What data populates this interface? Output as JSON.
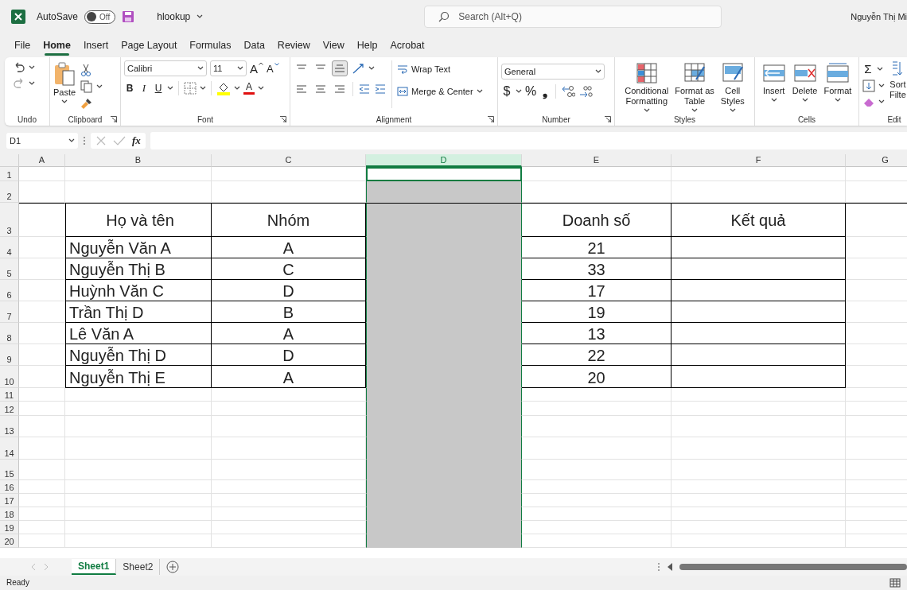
{
  "title_bar": {
    "autosave_label": "AutoSave",
    "autosave": {
      "on": false,
      "label": "Off"
    },
    "filename": "hlookup",
    "search": {
      "placeholder": "Search (Alt+Q)"
    },
    "user": "Nguyễn Thị Mi"
  },
  "menu_tabs": [
    {
      "label": "File",
      "selected": false
    },
    {
      "label": "Home",
      "selected": true
    },
    {
      "label": "Insert",
      "selected": false
    },
    {
      "label": "Page Layout",
      "selected": false
    },
    {
      "label": "Formulas",
      "selected": false
    },
    {
      "label": "Data",
      "selected": false
    },
    {
      "label": "Review",
      "selected": false
    },
    {
      "label": "View",
      "selected": false
    },
    {
      "label": "Help",
      "selected": false
    },
    {
      "label": "Acrobat",
      "selected": false
    }
  ],
  "ribbon": {
    "undo": {
      "label": "Undo"
    },
    "clipboard": {
      "paste": "Paste",
      "label": "Clipboard"
    },
    "font": {
      "name": "Calibri",
      "size": "11",
      "grow": "A",
      "shrink": "A",
      "bold": "B",
      "italic": "I",
      "underline": "U",
      "color_letter": "A",
      "label": "Font"
    },
    "alignment": {
      "bottom_align_selected": true,
      "wrap_text": "Wrap Text",
      "merge": "Merge & Center",
      "label": "Alignment"
    },
    "number": {
      "format": "General",
      "currency": "$",
      "percent": "%",
      "comma": "❟",
      "label": "Number"
    },
    "styles": {
      "buttons": [
        "Conditional\nFormatting",
        "Format as\nTable",
        "Cell\nStyles"
      ],
      "label": "Styles"
    },
    "cells": {
      "buttons": [
        "Insert",
        "Delete",
        "Format"
      ],
      "label": "Cells"
    },
    "editing": {
      "sum": "Σ",
      "sort": "Sort\nFilte",
      "label": "Edit"
    }
  },
  "formula_bar": {
    "name_box": "D1",
    "fx": "fx"
  },
  "columns": [
    {
      "label": "A",
      "selected": false
    },
    {
      "label": "B",
      "selected": false
    },
    {
      "label": "C",
      "selected": false
    },
    {
      "label": "D",
      "selected": true
    },
    {
      "label": "E",
      "selected": false
    },
    {
      "label": "F",
      "selected": false
    },
    {
      "label": "G",
      "selected": false
    }
  ],
  "rows": [
    {
      "header": "1",
      "kind": "empty"
    },
    {
      "header": "2",
      "kind": "empty"
    },
    {
      "header": "3",
      "kind": "table_header",
      "cells": {
        "B": "Họ và tên",
        "C": "Nhóm",
        "E": "Doanh số",
        "F": "Kết quả"
      }
    },
    {
      "header": "4",
      "kind": "table_row",
      "cells": {
        "B": "Nguyễn Văn A",
        "C": "A",
        "E": "21"
      }
    },
    {
      "header": "5",
      "kind": "table_row",
      "cells": {
        "B": "Nguyễn Thị B",
        "C": "C",
        "E": "33"
      }
    },
    {
      "header": "6",
      "kind": "table_row",
      "cells": {
        "B": "Huỳnh Văn C",
        "C": "D",
        "E": "17"
      }
    },
    {
      "header": "7",
      "kind": "table_row",
      "cells": {
        "B": "Trần Thị D",
        "C": "B",
        "E": "19"
      }
    },
    {
      "header": "8",
      "kind": "table_row",
      "cells": {
        "B": "Lê Văn A",
        "C": "A",
        "E": "13"
      }
    },
    {
      "header": "9",
      "kind": "table_row",
      "cells": {
        "B": "Nguyễn Thị D",
        "C": "D",
        "E": "22"
      }
    },
    {
      "header": "10",
      "kind": "table_row",
      "cells": {
        "B": "Nguyễn Thị E",
        "C": "A",
        "E": "20"
      }
    },
    {
      "header": "11",
      "kind": "empty"
    },
    {
      "header": "12",
      "kind": "empty"
    },
    {
      "header": "13",
      "kind": "empty"
    },
    {
      "header": "14",
      "kind": "empty"
    },
    {
      "header": "15",
      "kind": "empty"
    },
    {
      "header": "16",
      "kind": "empty"
    },
    {
      "header": "17",
      "kind": "empty"
    },
    {
      "header": "18",
      "kind": "empty"
    },
    {
      "header": "19",
      "kind": "empty"
    },
    {
      "header": "20",
      "kind": "empty"
    }
  ],
  "sheet_tabs": [
    {
      "label": "Sheet1",
      "selected": true
    },
    {
      "label": "Sheet2",
      "selected": false
    }
  ],
  "status_bar": {
    "text": "Ready"
  }
}
